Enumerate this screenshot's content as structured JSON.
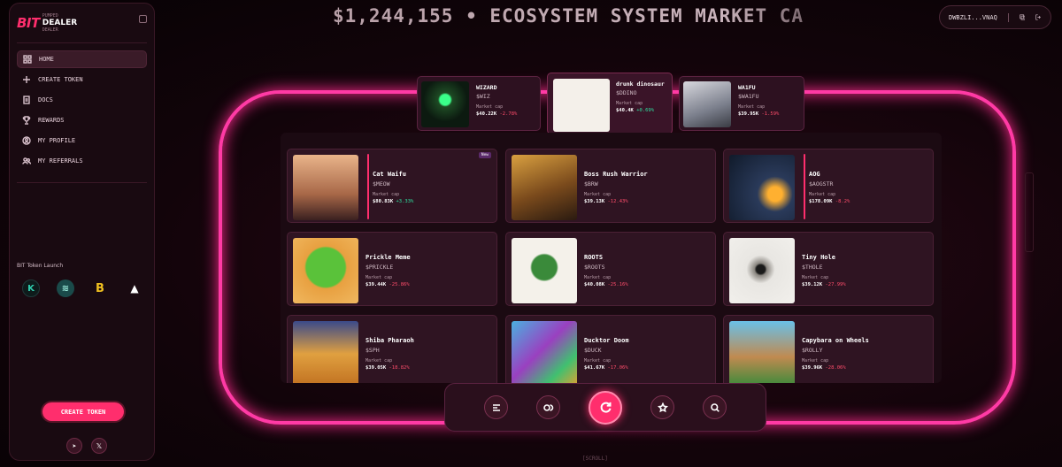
{
  "brand": {
    "bit": "BIT",
    "top": "PUMPED",
    "dealer": "DEALER",
    "bottom": "DEALER"
  },
  "nav": [
    {
      "label": "HOME",
      "icon": "home-grid-icon"
    },
    {
      "label": "CREATE TOKEN",
      "icon": "plus-icon"
    },
    {
      "label": "DOCS",
      "icon": "docs-icon"
    },
    {
      "label": "REWARDS",
      "icon": "trophy-icon"
    },
    {
      "label": "MY PROFILE",
      "icon": "user-icon"
    },
    {
      "label": "MY REFERRALS",
      "icon": "users-icon"
    }
  ],
  "launch": {
    "title": "BIT Token Launch"
  },
  "create_label": "CREATE TOKEN",
  "ticker": "$1,244,155 • ECOSYSTEM SYSTEM MARKET CA",
  "wallet": "DWBZLI...VNAQ",
  "kings": [
    {
      "name": "WIZARD",
      "ticker": "$WIZ",
      "mclabel": "Market cap",
      "mc": "$40.22K",
      "change": "-2.78%"
    },
    {
      "name": "drunk dinosaur",
      "ticker": "$DDINO",
      "mclabel": "Market cap",
      "mc": "$40.4K",
      "change": "+0.69%"
    },
    {
      "name": "WA1FU",
      "ticker": "$WA1FU",
      "mclabel": "Market cap",
      "mc": "$39.95K",
      "change": "-1.59%"
    }
  ],
  "cards": [
    {
      "name": "Cat Waifu",
      "ticker": "$MEOW",
      "mclabel": "Market cap",
      "mc": "$80.83K",
      "change": "+3.33%",
      "badge": "New"
    },
    {
      "name": "Boss Rush Warrior",
      "ticker": "$BRW",
      "mclabel": "Market cap",
      "mc": "$39.13K",
      "change": "-12.43%"
    },
    {
      "name": "AOG",
      "ticker": "$AOGSTR",
      "mclabel": "Market cap",
      "mc": "$178.09K",
      "change": "-8.2%"
    },
    {
      "name": "Prickle Meme",
      "ticker": "$PRICKLE",
      "mclabel": "Market cap",
      "mc": "$39.44K",
      "change": "-25.86%"
    },
    {
      "name": "ROOTS",
      "ticker": "$ROOTS",
      "mclabel": "Market cap",
      "mc": "$40.08K",
      "change": "-25.16%"
    },
    {
      "name": "Tiny Hole",
      "ticker": "$THOLE",
      "mclabel": "Market cap",
      "mc": "$39.12K",
      "change": "-27.99%"
    },
    {
      "name": "Shiba Pharaoh",
      "ticker": "$SPH",
      "mclabel": "Market cap",
      "mc": "$39.05K",
      "change": "-18.82%"
    },
    {
      "name": "Ducktor Doom",
      "ticker": "$DUCK",
      "mclabel": "Market cap",
      "mc": "$41.67K",
      "change": "-17.06%"
    },
    {
      "name": "Capybara on Wheels",
      "ticker": "$ROLLY",
      "mclabel": "Market cap",
      "mc": "$39.96K",
      "change": "-28.06%"
    }
  ],
  "scroll": "[SCROLL]",
  "colors": {
    "accent": "#ff2e6d",
    "neon": "#ff3aa5",
    "up": "#2fe0a0",
    "down": "#ff4d6b"
  }
}
